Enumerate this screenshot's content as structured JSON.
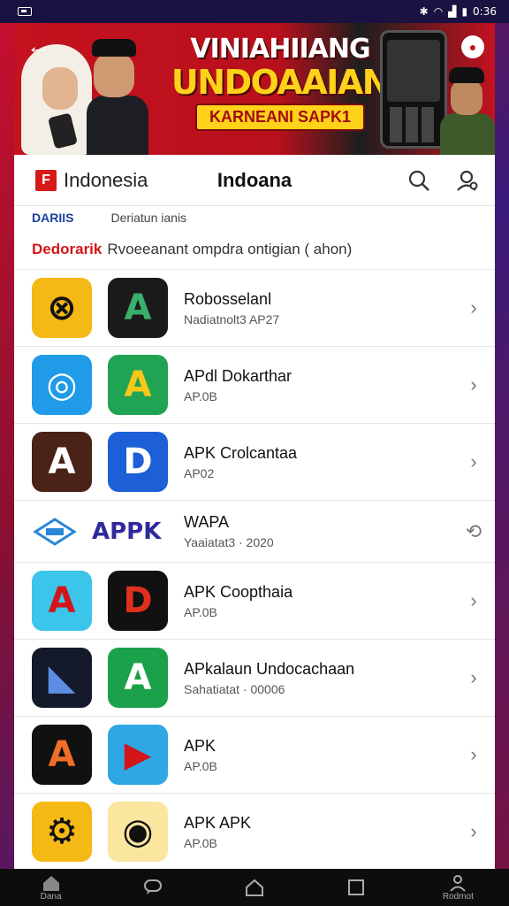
{
  "status": {
    "time": "0:36",
    "left_icons": [
      "notification-box-icon"
    ],
    "right_icons": [
      "bluetooth-icon",
      "wifi-icon",
      "signal-icon",
      "battery-icon"
    ]
  },
  "banner": {
    "line1": "VINIAHIIANG",
    "line2": "UNDOAAIAN",
    "line3": "KARNEANI SAPK1"
  },
  "appbar": {
    "brand": "Indonesia",
    "title": "Indoana",
    "logo_letter": "F"
  },
  "tabs": {
    "active": "DARIIS",
    "inactive": "Deriatun ianis"
  },
  "section": {
    "label": "Dedorarik",
    "description": "Rvoeeanant ompdra ontigian ( ahon)"
  },
  "apps": [
    {
      "name": "Robosselanl",
      "sub": "Nadiatnolt3 AP27",
      "icon1": {
        "bg": "#f5b915",
        "fg": "#111",
        "glyph": "⊗"
      },
      "icon2": {
        "bg": "#1b1b1b",
        "fg": "#3ab06a",
        "glyph": "A"
      }
    },
    {
      "name": "APdl Dokarthar",
      "sub": "AP.0B",
      "icon1": {
        "bg": "#1f9be8",
        "fg": "#fff",
        "glyph": "◎"
      },
      "icon2": {
        "bg": "#20a352",
        "fg": "#f7c71a",
        "glyph": "A"
      }
    },
    {
      "name": "APK Crolcantaa",
      "sub": "AP02",
      "icon1": {
        "bg": "#4a2217",
        "fg": "#fff",
        "glyph": "A"
      },
      "icon2": {
        "bg": "#1c5fd6",
        "fg": "#fff",
        "glyph": "D"
      }
    },
    {
      "name": "WAPA",
      "sub": "Yaaiatat3 · 2020",
      "brand_word": "APPK",
      "short": true
    },
    {
      "name": "APK Coopthaia",
      "sub": "AP.0B",
      "icon1": {
        "bg": "#3cc5ea",
        "fg": "#d3151a",
        "glyph": "A"
      },
      "icon2": {
        "bg": "#111",
        "fg": "#e0301e",
        "glyph": "D"
      }
    },
    {
      "name": "APkalaun Undocachaan",
      "sub": "Sahatiatat · 00006",
      "icon1": {
        "bg": "#151a2a",
        "fg": "#5d8de3",
        "glyph": "◣"
      },
      "icon2": {
        "bg": "#1aa14a",
        "fg": "#fff",
        "glyph": "A"
      }
    },
    {
      "name": "APK",
      "sub": "AP.0B",
      "icon1": {
        "bg": "#111",
        "fg": "#f06d2a",
        "glyph": "A"
      },
      "icon2": {
        "bg": "#2fa7e5",
        "fg": "#d3151a",
        "glyph": "▶"
      }
    },
    {
      "name": "APK APK",
      "sub": "AP.0B",
      "icon1": {
        "bg": "#f5b915",
        "fg": "#111",
        "glyph": "⚙"
      },
      "icon2": {
        "bg": "#fbe6a0",
        "fg": "#111",
        "glyph": "◉"
      }
    }
  ],
  "nav": {
    "home": "Dana",
    "right": "Rodmot"
  }
}
